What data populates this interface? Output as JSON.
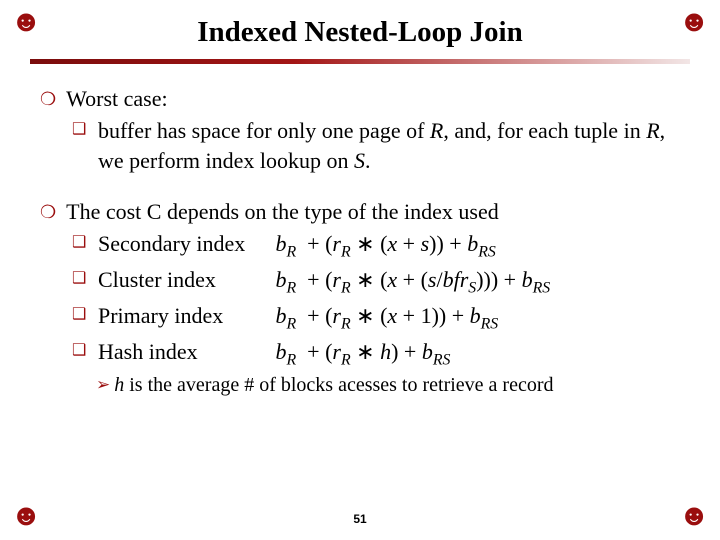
{
  "title": "Indexed Nested-Loop Join",
  "bullets": {
    "b1": {
      "head": "Worst case:",
      "sub1_pre": "buffer has space for only one page of ",
      "sub1_R": "R",
      "sub1_mid": ", and, for each tuple in ",
      "sub1_R2": "R",
      "sub1_mid2": ", we perform index lookup on ",
      "sub1_S": "S",
      "sub1_end": "."
    },
    "b2": {
      "head": "The cost C depends on the type of the index used",
      "rows": {
        "r1": {
          "label": "Secondary index",
          "formula_plain": "bR  + (rR ∗ (x + s)) + bRS"
        },
        "r2": {
          "label": "Cluster index",
          "formula_plain": "bR  + (rR ∗ (x + (s/bfrS))) + bRS"
        },
        "r3": {
          "label": "Primary index",
          "formula_plain": "bR  + (rR ∗ (x + 1)) + bRS"
        },
        "r4": {
          "label": "Hash index",
          "formula_plain": "bR  + (rR ∗ h) + bRS"
        }
      },
      "note_h": "h",
      "note_rest": " is the average # of blocks acesses to retrieve a record"
    }
  },
  "page_number": "51",
  "icons": {
    "corner": "smiley"
  }
}
